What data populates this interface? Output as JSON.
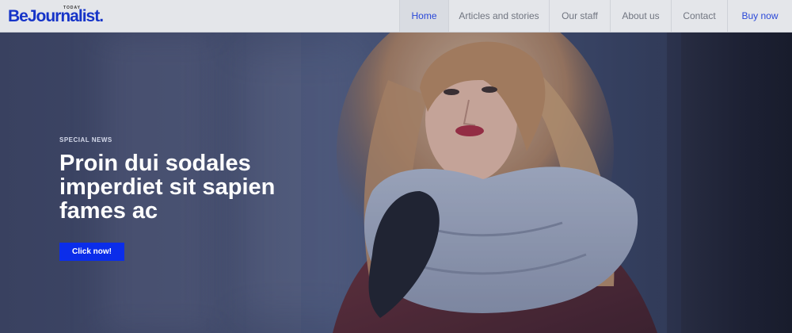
{
  "brand": {
    "name": "BeJournalist",
    "dot": ".",
    "tagline": "TODAY",
    "accent_color": "#1634c8"
  },
  "nav": {
    "items": [
      {
        "label": "Home",
        "active": true
      },
      {
        "label": "Articles and stories",
        "active": false
      },
      {
        "label": "Our staff",
        "active": false
      },
      {
        "label": "About us",
        "active": false
      },
      {
        "label": "Contact",
        "active": false
      },
      {
        "label": "Buy now",
        "active": false
      }
    ]
  },
  "hero": {
    "eyebrow": "SPECIAL NEWS",
    "headline": "Proin dui sodales imperdiet sit sapien fames ac",
    "cta_label": "Click now!",
    "cta_color": "#0b2dea",
    "image": "woman-in-scarf-photo"
  }
}
